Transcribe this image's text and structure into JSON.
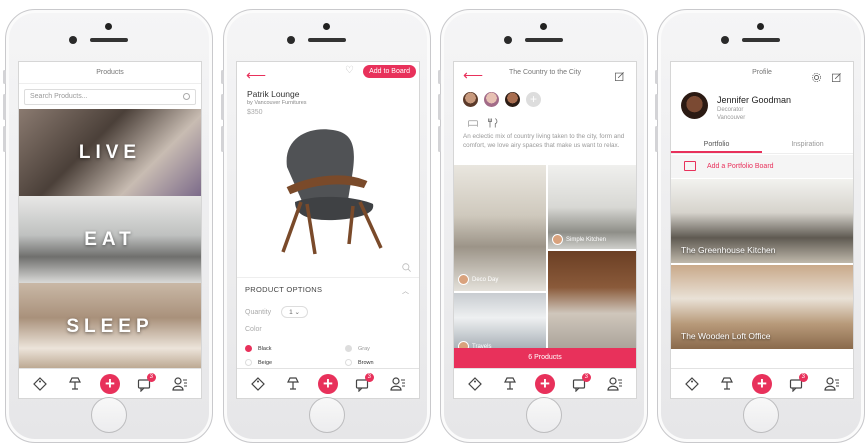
{
  "phone1": {
    "title": "Products",
    "search_placeholder": "Search Products...",
    "tiles": [
      "LIVE",
      "EAT",
      "SLEEP"
    ]
  },
  "phone2": {
    "add_button": "Add to Board",
    "product_name": "Patrik Lounge",
    "brand": "by Vancouver Furnitures",
    "price": "$350",
    "options_title": "PRODUCT OPTIONS",
    "quantity_label": "Quantity",
    "quantity_value": "1",
    "color_label": "Color",
    "colors": [
      {
        "name": "Black",
        "swatch": "#e8315b",
        "selected": true
      },
      {
        "name": "Gray",
        "swatch": "#dddddd",
        "selected": false
      },
      {
        "name": "Beige",
        "swatch": "#ffffff",
        "selected": false
      },
      {
        "name": "Brown",
        "swatch": "#ffffff",
        "selected": false
      }
    ]
  },
  "phone3": {
    "title": "The Country to the City",
    "description": "An eclectic mix of country living taken to the city, form and comfort, we love airy spaces that make us want to relax.",
    "tags": [
      "Simple Kitchen",
      "Deco Day",
      "Travels"
    ],
    "products_bar": "6 Products"
  },
  "phone4": {
    "title": "Profile",
    "name": "Jennifer Goodman",
    "role": "Decorator",
    "city": "Vancouver",
    "tabs": [
      "Portfolio",
      "Inspiration"
    ],
    "add_board": "Add a Portfolio Board",
    "boards": [
      "The Greenhouse Kitchen",
      "The Wooden Loft Office"
    ]
  },
  "tabbar": {
    "icons": [
      "tag-icon",
      "lamp-icon",
      "plus-icon",
      "messages-icon",
      "profile-icon"
    ],
    "badge_count": "3",
    "plus_glyph": "+"
  },
  "colors": {
    "accent": "#e8315b"
  }
}
